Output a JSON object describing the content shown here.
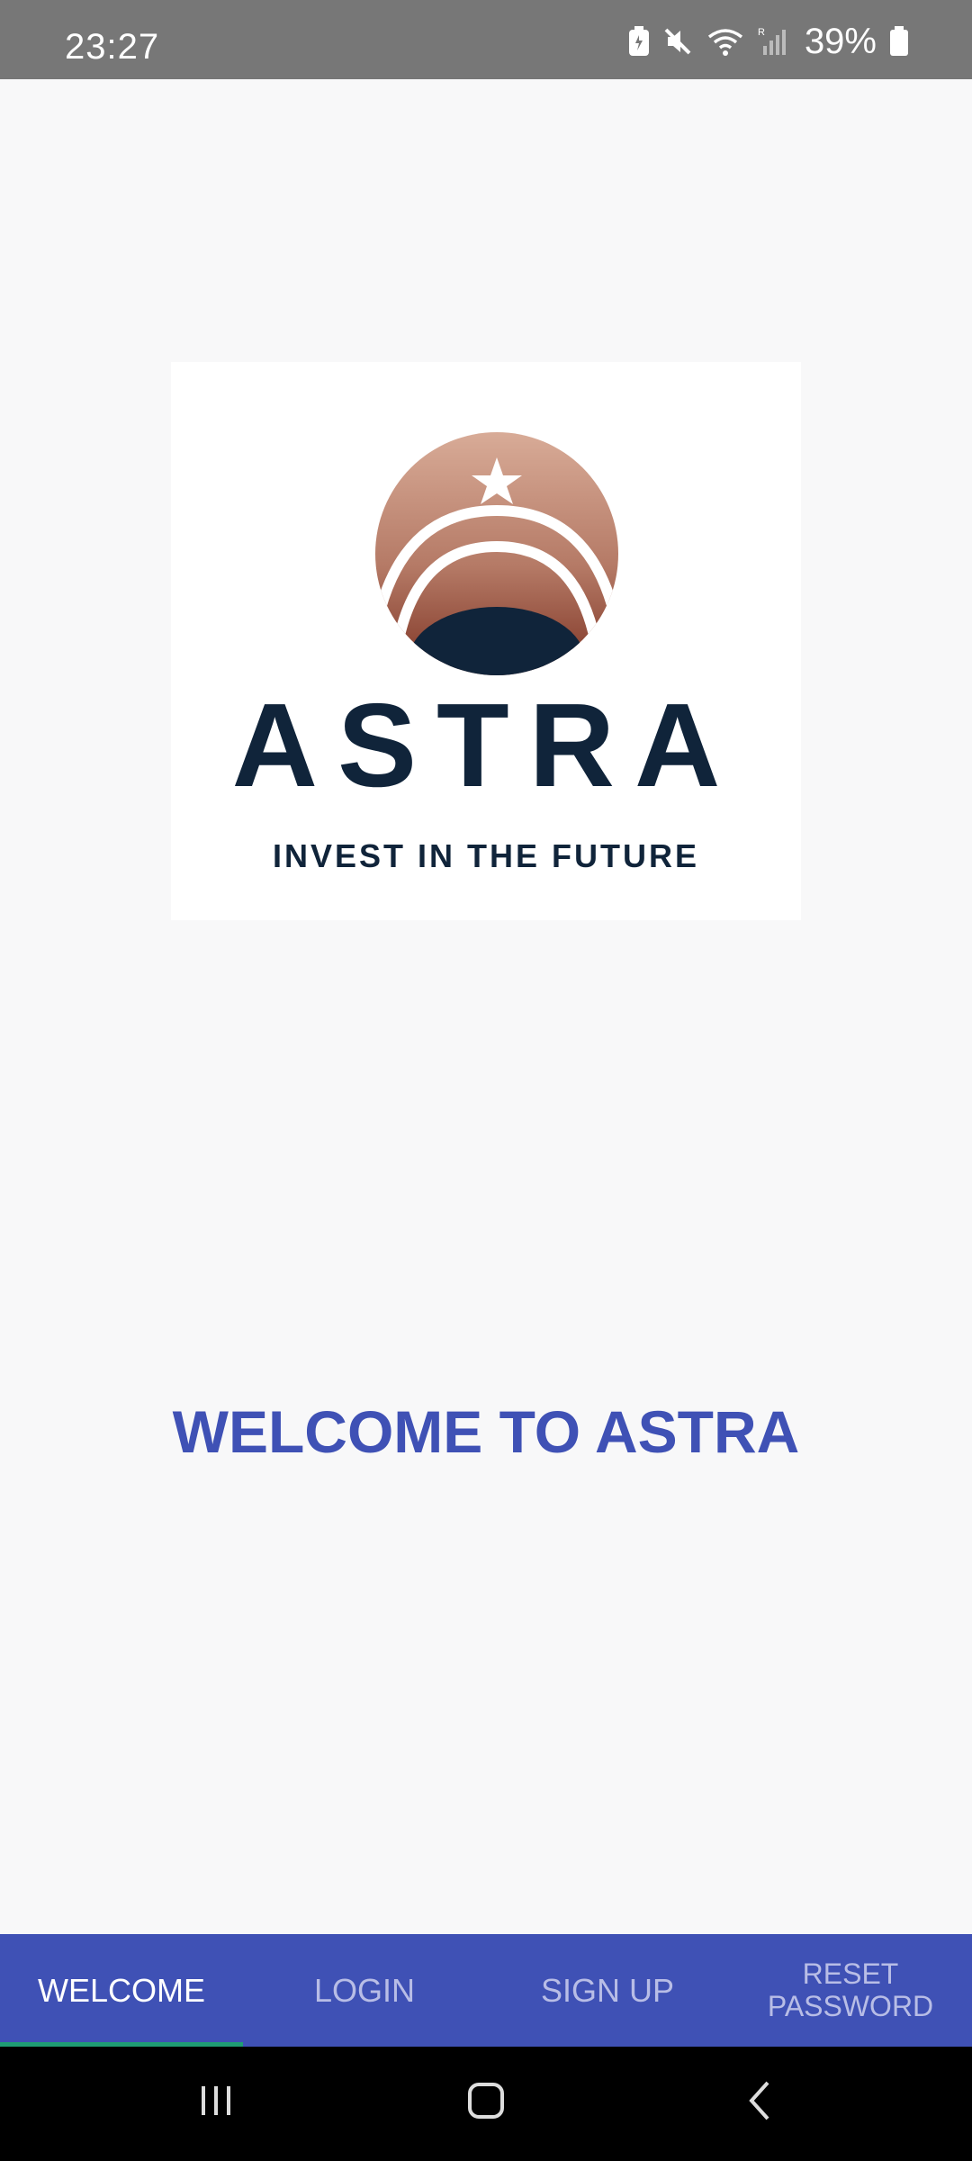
{
  "status_bar": {
    "time": "23:27",
    "battery_percent": "39%",
    "icons": [
      "battery-saver-icon",
      "mute-icon",
      "wifi-icon",
      "signal-icon",
      "battery-icon"
    ]
  },
  "logo": {
    "wordmark": "ASTRA",
    "tagline": "INVEST IN THE FUTURE",
    "colors": {
      "navy": "#10243a",
      "copper_light": "#d4a591",
      "copper_dark": "#8a3c2e"
    }
  },
  "welcome": {
    "title": "WELCOME TO ASTRA"
  },
  "tabs": [
    {
      "label": "WELCOME",
      "active": true
    },
    {
      "label": "LOGIN",
      "active": false
    },
    {
      "label": "SIGN UP",
      "active": false
    },
    {
      "label": "RESET\nPASSWORD",
      "active": false
    }
  ],
  "nav_bar": {
    "buttons": [
      "recents-icon",
      "home-icon",
      "back-icon"
    ]
  },
  "colors": {
    "accent": "#3f51b5",
    "tab_indicator": "#1f9d74",
    "background": "#f8f8f9"
  }
}
